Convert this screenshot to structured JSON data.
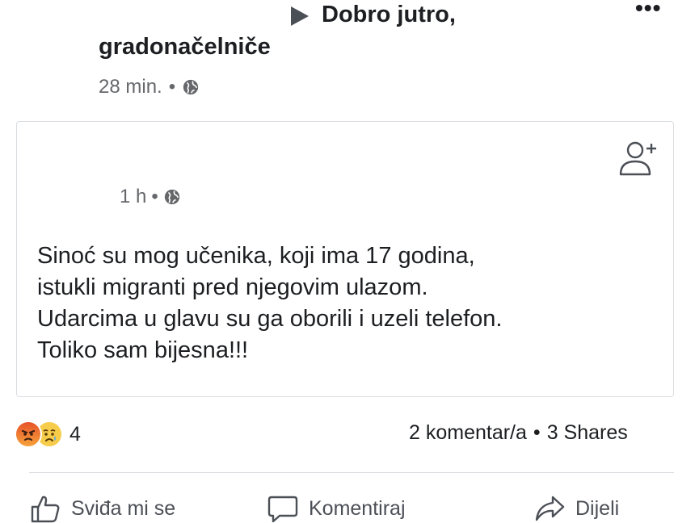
{
  "header": {
    "title_line1": "Dobro jutro,",
    "title_line2": "gradonačelniče",
    "time": "28 min.",
    "separator": "•",
    "more": "•••"
  },
  "shared_post": {
    "time": "1 h",
    "separator": "•",
    "text_lines": [
      "Sinoć su mog učenika, koji ima 17 godina,",
      "istukli migranti pred njegovim ulazom.",
      "Udarcima u glavu su ga oborili i uzeli telefon.",
      "Toliko sam bijesna!!!"
    ]
  },
  "stats": {
    "reaction_icons": [
      "angry-icon",
      "sad-icon"
    ],
    "reaction_count": "4",
    "comments": "2 komentar/a",
    "separator": "•",
    "shares": "3 Shares"
  },
  "actions": {
    "like": "Sviđa mi se",
    "comment": "Komentiraj",
    "share": "Dijeli"
  },
  "colors": {
    "text": "#1c1e21",
    "meta": "#65676b",
    "divider": "#dadde1",
    "angry": "#e8532c",
    "sad": "#f6cc4a"
  }
}
